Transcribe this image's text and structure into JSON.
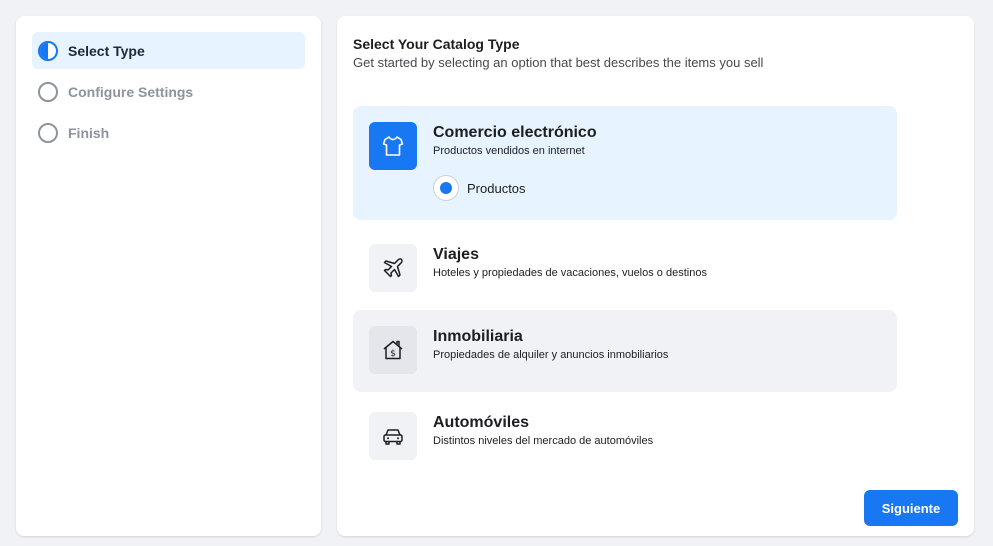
{
  "steps": [
    {
      "label": "Select Type",
      "state": "active"
    },
    {
      "label": "Configure Settings",
      "state": "pending"
    },
    {
      "label": "Finish",
      "state": "pending"
    }
  ],
  "main": {
    "title": "Select Your Catalog Type",
    "subtitle": "Get started by selecting an option that best describes the items you sell",
    "options": [
      {
        "title": "Comercio electrónico",
        "description": "Productos vendidos en internet",
        "icon": "tshirt-icon",
        "selected": true,
        "sub_option": "Productos"
      },
      {
        "title": "Viajes",
        "description": "Hoteles y propiedades de vacaciones, vuelos o destinos",
        "icon": "airplane-icon"
      },
      {
        "title": "Inmobiliaria",
        "description": "Propiedades de alquiler y anuncios inmobiliarios",
        "icon": "house-dollar-icon"
      },
      {
        "title": "Automóviles",
        "description": "Distintos niveles del mercado de automóviles",
        "icon": "car-icon"
      }
    ],
    "next_label": "Siguiente"
  },
  "colors": {
    "accent": "#1877f2",
    "selected_bg": "#e7f3ff",
    "hover_bg": "#f0f2f5",
    "page_bg": "#f0f2f5"
  }
}
